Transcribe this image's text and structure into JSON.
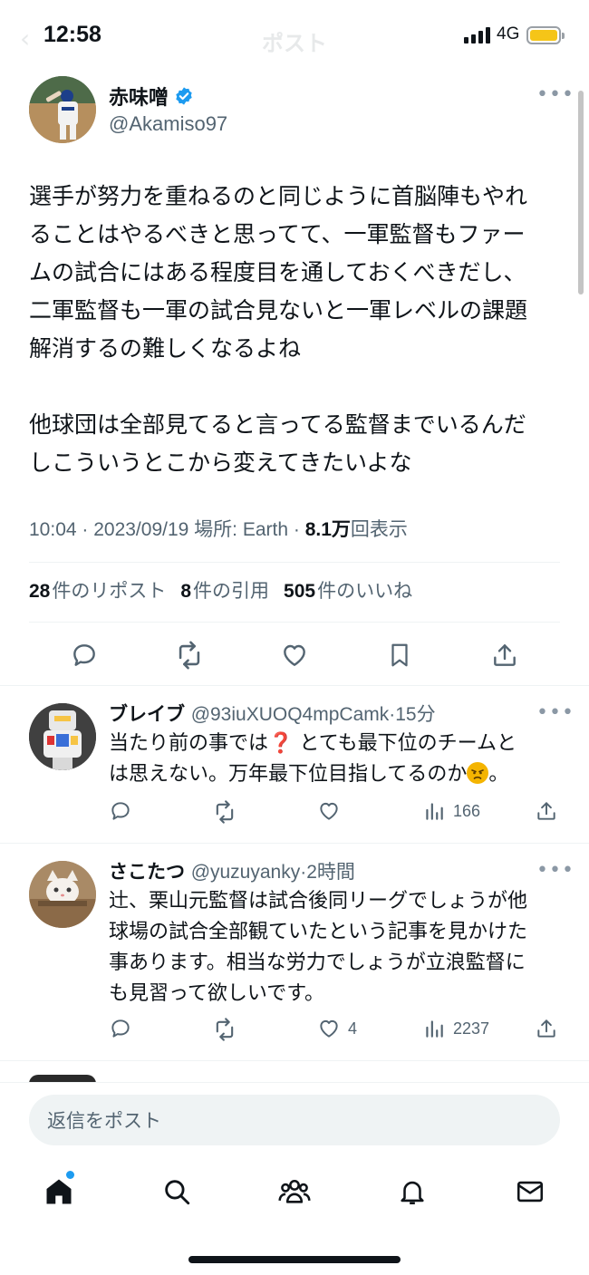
{
  "status_bar": {
    "time": "12:58",
    "network": "4G"
  },
  "nav": {
    "title": "ポスト"
  },
  "main_tweet": {
    "name": "赤味噌",
    "handle": "@Akamiso97",
    "body_lines": [
      "選手が努力を重ねるのと同じように首脳陣もやれ",
      "ることはやるべきと思ってて、一軍監督もファー",
      "ムの試合にはある程度目を通しておくべきだし、",
      "二軍監督も一軍の試合見ないと一軍レベルの課題",
      "解消するの難しくなるよね",
      "",
      "他球団は全部見てると言ってる監督までいるんだ",
      "しこういうとこから変えてきたいよな"
    ],
    "meta_prefix": "10:04 · 2023/09/19 場所: Earth · ",
    "views_count": "8.1万",
    "views_label": "回表示",
    "stats": {
      "reposts_count": "28",
      "reposts_label": "件のリポスト",
      "quotes_count": "8",
      "quotes_label": "件の引用",
      "likes_count": "505",
      "likes_label": "件のいいね"
    }
  },
  "replies": [
    {
      "name": "ブレイブ",
      "handle": "@93iuXUOQ4mpCamk",
      "time": "·15分",
      "line1": "当たり前の事では❓ とても最下位のチームと",
      "line2_text": "は思えない。万年最下位目指してるのか",
      "line2_end": "。",
      "likes": "",
      "views": "166"
    },
    {
      "name": "さこたつ",
      "handle": "@yuzuyanky",
      "time": "·2時間",
      "lines": [
        "辻、栗山元監督は試合後同リーグでしょうが他",
        "球場の試合全部観ていたという記事を見かけた",
        "事あります。相当な労力でしょうが立浪監督に",
        "も見習って欲しいです。"
      ],
      "likes": "4",
      "views": "2237"
    }
  ],
  "compose": {
    "placeholder": "返信をポスト"
  }
}
